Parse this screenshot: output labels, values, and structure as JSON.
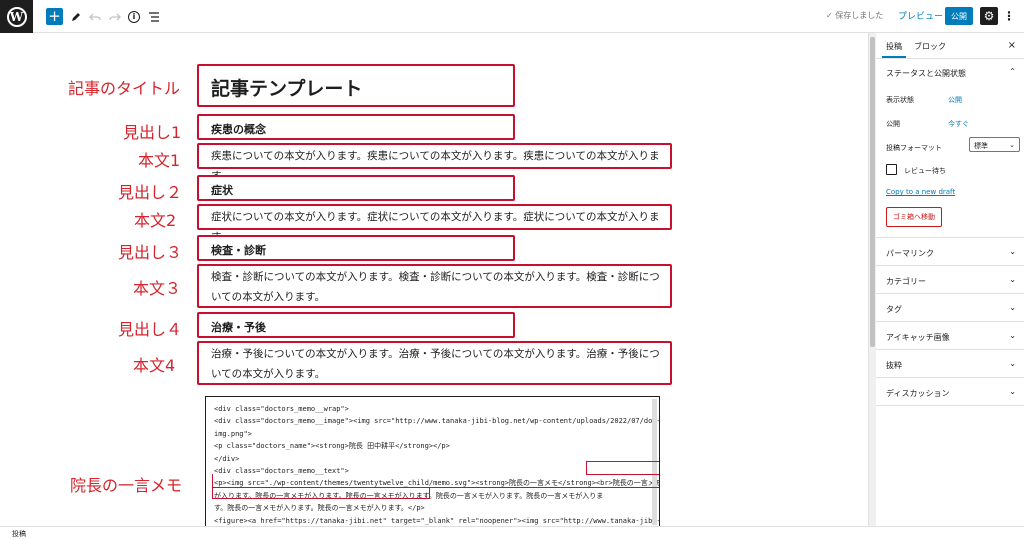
{
  "toolbar": {
    "wp_logo": "W",
    "add_icon": "+",
    "edit_icon": "pen-icon",
    "undo_icon": "undo-icon",
    "redo_icon": "redo-icon",
    "info_icon": "i",
    "outline_icon": "list-view-icon",
    "saved_label": "✓ 保存しました",
    "preview_label": "プレビュー",
    "publish_label": "公開",
    "settings_icon": "gear-icon",
    "more_icon": "⋮"
  },
  "content": {
    "labels": {
      "title": "記事のタイトル",
      "h1": "見出し1",
      "b1": "本文1",
      "h2": "見出し２",
      "b2": "本文2",
      "h3": "見出し３",
      "b3": "本文３",
      "h4": "見出し４",
      "b4": "本文4",
      "memo": "院長の一言メモ"
    },
    "title": "記事テンプレート",
    "heading1": "疾患の概念",
    "body1": "疾患についての本文が入ります。疾患についての本文が入ります。疾患についての本文が入ります。",
    "heading2": "症状",
    "body2": "症状についての本文が入ります。症状についての本文が入ります。症状についての本文が入ります。",
    "heading3": "検査・診断",
    "body3": "検査・診断についての本文が入ります。検査・診断についての本文が入ります。検査・診断についての本文が入ります。",
    "heading4": "治療・予後",
    "body4": "治療・予後についての本文が入ります。治療・予後についての本文が入ります。治療・予後についての本文が入ります。",
    "code": "<div class=\"doctors_memo__wrap\">\n<div class=\"doctors_memo__image\"><img src=\"http://www.tanaka-jibi-blog.net/wp-content/uploads/2022/07/doc-\nimg.png\">\n<p class=\"doctors_name\"><strong>院長 田中耕平</strong></p>\n</div>\n<div class=\"doctors_memo__text\">\n<p><img src=\"./wp-content/themes/twentytwelve_child/memo.svg\"><strong>院長の一言メモ</strong><br>院長の一言メモ\nが入ります。院長の一言メモが入ります。院長の一言メモが入ります。院長の一言メモが入ります。院長の一言メモが入りま\nす。院長の一言メモが入ります。院長の一言メモが入ります。</p>\n<figure><a href=\"https://tanaka-jibi.net\" target=\"_blank\" rel=\"noopener\"><img src=\"http://www.tanaka-jibi-\nblog.net/wp-content/uploads/2022/07/toC-bnr.jpg\"></a></figure>\n</div>"
  },
  "sidebar": {
    "tab_post": "投稿",
    "tab_block": "ブロック",
    "close_icon": "×",
    "status_title": "ステータスと公開状態",
    "visibility_label": "表示状態",
    "visibility_value": "公開",
    "publish_label": "公開",
    "publish_value": "今すぐ",
    "format_label": "投稿フォーマット",
    "format_value": "標準",
    "review_label": "レビュー待ち",
    "copy_link": "Copy to a new draft",
    "trash_button": "ゴミ箱へ移動",
    "panels": [
      "パーマリンク",
      "カテゴリー",
      "タグ",
      "アイキャッチ画像",
      "抜粋",
      "ディスカッション"
    ]
  },
  "footer": {
    "breadcrumb": "投稿"
  }
}
